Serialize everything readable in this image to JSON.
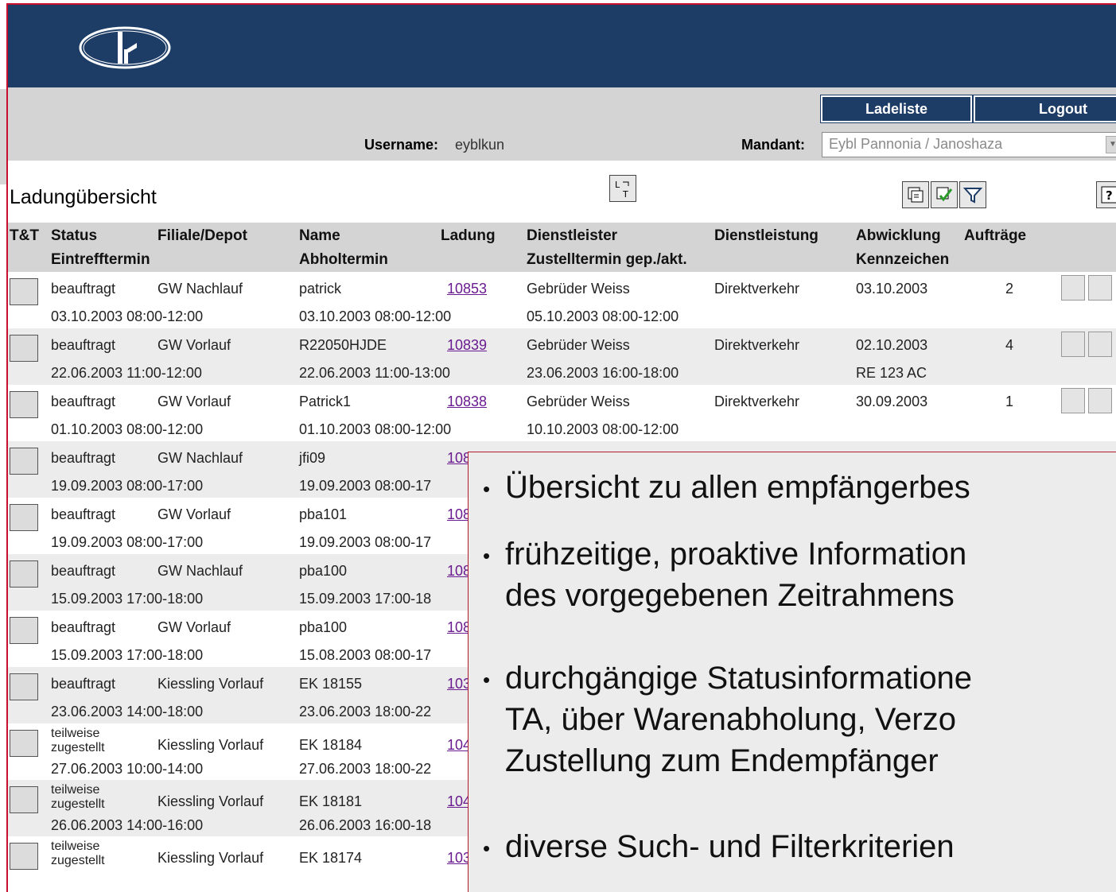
{
  "toolbar": {
    "ladeliste_label": "Ladeliste",
    "logout_label": "Logout",
    "username_label": "Username:",
    "username_value": "eyblkun",
    "mandant_label": "Mandant:",
    "mandant_value": "Eybl Pannonia / Janoshaza"
  },
  "page": {
    "title": "Ladungübersicht"
  },
  "columns": {
    "tt": "T&T",
    "status": "Status",
    "eintrefftermin": "Eintrefftermin",
    "filiale": "Filiale/Depot",
    "name": "Name",
    "abholtermin": "Abholtermin",
    "ladung": "Ladung",
    "dienstleister": "Dienstleister",
    "zustelltermin": "Zustelltermin gep./akt.",
    "dienstleistung": "Dienstleistung",
    "abwicklung": "Abwicklung",
    "kennzeichen": "Kennzeichen",
    "auftraege": "Aufträge"
  },
  "rows": [
    {
      "status": "beauftragt",
      "filiale": "GW Nachlauf",
      "name": "patrick",
      "ladung": "10853",
      "dienstleister": "Gebrüder Weiss",
      "dienstleistung": "Direktverkehr",
      "abwicklung": "03.10.2003",
      "auftraege": "2",
      "eintreff": "03.10.2003 08:00-12:00",
      "abhol": "03.10.2003 08:00-12:00",
      "zustell": "05.10.2003 08:00-12:00",
      "kennzeichen": ""
    },
    {
      "status": "beauftragt",
      "filiale": "GW Vorlauf",
      "name": "R22050HJDE",
      "ladung": "10839",
      "dienstleister": "Gebrüder Weiss",
      "dienstleistung": "Direktverkehr",
      "abwicklung": "02.10.2003",
      "auftraege": "4",
      "eintreff": "22.06.2003 11:00-12:00",
      "abhol": "22.06.2003 11:00-13:00",
      "zustell": "23.06.2003 16:00-18:00",
      "kennzeichen": "RE 123 AC"
    },
    {
      "status": "beauftragt",
      "filiale": "GW Vorlauf",
      "name": "Patrick1",
      "ladung": "10838",
      "dienstleister": "Gebrüder Weiss",
      "dienstleistung": "Direktverkehr",
      "abwicklung": "30.09.2003",
      "auftraege": "1",
      "eintreff": "01.10.2003 08:00-12:00",
      "abhol": "01.10.2003 08:00-12:00",
      "zustell": "10.10.2003 08:00-12:00",
      "kennzeichen": ""
    },
    {
      "status": "beauftragt",
      "filiale": "GW Nachlauf",
      "name": "jfi09",
      "ladung": "108",
      "eintreff": "19.09.2003 08:00-17:00",
      "abhol": "19.09.2003 08:00-17"
    },
    {
      "status": "beauftragt",
      "filiale": "GW Vorlauf",
      "name": "pba101",
      "ladung": "108",
      "eintreff": "19.09.2003 08:00-17:00",
      "abhol": "19.09.2003 08:00-17"
    },
    {
      "status": "beauftragt",
      "filiale": "GW Nachlauf",
      "name": "pba100",
      "ladung": "108",
      "eintreff": "15.09.2003 17:00-18:00",
      "abhol": "15.09.2003 17:00-18"
    },
    {
      "status": "beauftragt",
      "filiale": "GW Vorlauf",
      "name": "pba100",
      "ladung": "108",
      "eintreff": "15.09.2003 17:00-18:00",
      "abhol": "15.08.2003 08:00-17"
    },
    {
      "status": "beauftragt",
      "filiale": "Kiessling Vorlauf",
      "name": "EK 18155",
      "ladung": "103",
      "eintreff": "23.06.2003 14:00-18:00",
      "abhol": "23.06.2003 18:00-22"
    },
    {
      "status_l1": "teilweise",
      "status_l2": "zugestellt",
      "filiale": "Kiessling Vorlauf",
      "name": "EK 18184",
      "ladung": "104",
      "eintreff": "27.06.2003 10:00-14:00",
      "abhol": "27.06.2003 18:00-22"
    },
    {
      "status_l1": "teilweise",
      "status_l2": "zugestellt",
      "filiale": "Kiessling Vorlauf",
      "name": "EK 18181",
      "ladung": "104",
      "eintreff": "26.06.2003 14:00-16:00",
      "abhol": "26.06.2003 16:00-18"
    },
    {
      "status_l1": "teilweise",
      "status_l2": "zugestellt",
      "filiale": "Kiessling Vorlauf",
      "name": "EK 18174",
      "ladung": "103"
    }
  ],
  "overlay": {
    "bullet_1": "Übersicht zu allen empfängerbes",
    "bullet_2_l1": "frühzeitige, proaktive Information",
    "bullet_2_l2": "des vorgegebenen Zeitrahmens",
    "bullet_3_l1": "durchgängige Statusinformatione",
    "bullet_3_l2": "TA, über Warenabholung, Verzo",
    "bullet_3_l3": "Zustellung zum Endempfänger",
    "bullet_4": "diverse Such- und Filterkriterien"
  },
  "icons": {
    "logo": "company-logo",
    "tt": "track-and-trace-icon",
    "print": "print-icon",
    "help": "help-icon",
    "filter": "filter-icon"
  }
}
